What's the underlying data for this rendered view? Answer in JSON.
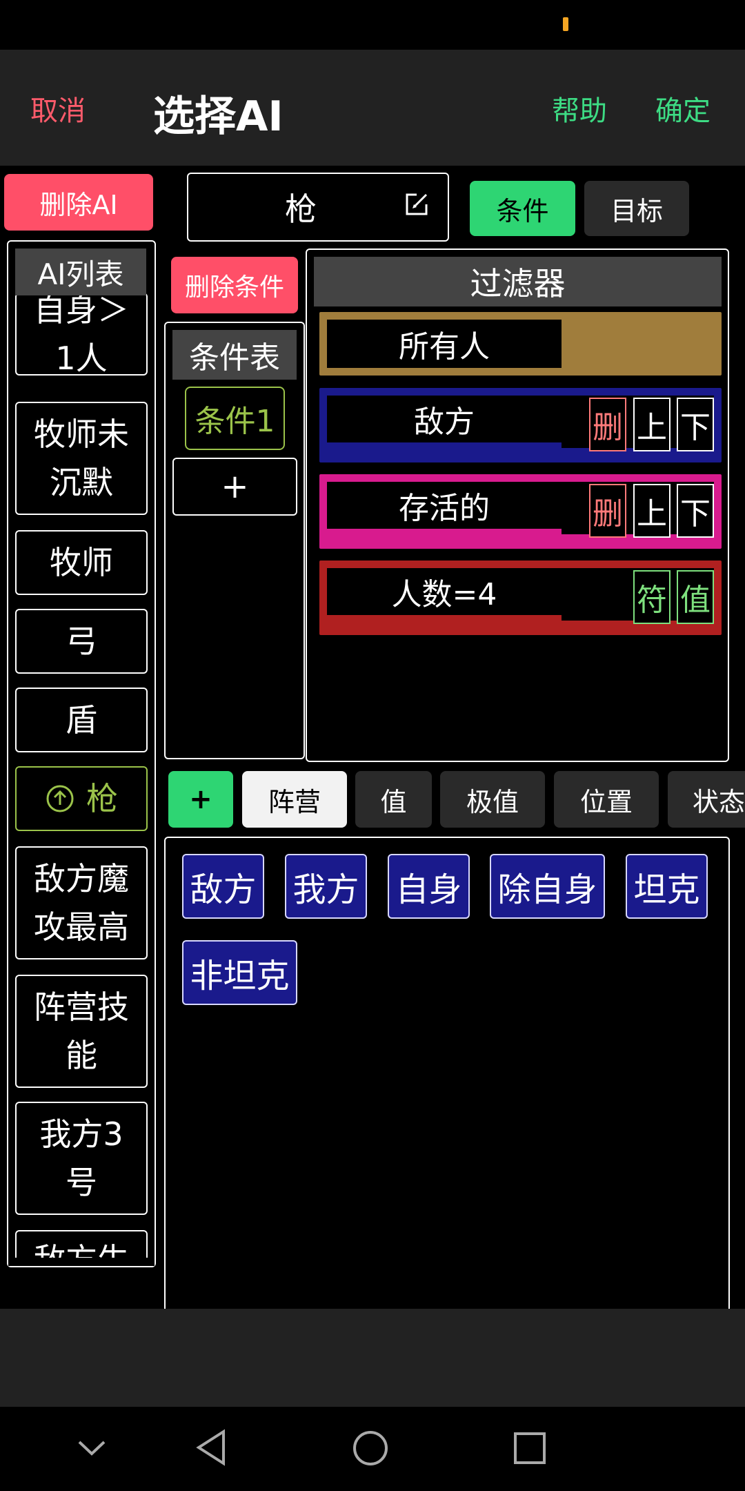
{
  "header": {
    "cancel": "取消",
    "title": "选择AI",
    "help": "帮助",
    "confirm": "确定"
  },
  "ai_panel": {
    "delete_button": "删除AI",
    "list_title": "AI列表",
    "items": [
      "自身＞\n1人",
      "牧师未\n沉默",
      "牧师",
      "弓",
      "盾",
      "枪",
      "敌方魔\n攻最高",
      "阵营技\n能",
      "我方3\n号",
      "敌方生"
    ],
    "selected": "枪"
  },
  "editor": {
    "name": "枪",
    "tab_condition": "条件",
    "tab_target": "目标"
  },
  "conditions": {
    "delete_button": "删除条件",
    "table_title": "条件表",
    "items": [
      "条件1"
    ],
    "add": "+"
  },
  "filter": {
    "title": "过滤器",
    "rows": [
      {
        "label": "所有人",
        "color": "#a07d3c",
        "buttons": []
      },
      {
        "label": "敌方",
        "color": "#1a1a8c",
        "buttons": [
          "删",
          "上",
          "下"
        ]
      },
      {
        "label": "存活的",
        "color": "#d81b8e",
        "buttons": [
          "删",
          "上",
          "下"
        ]
      },
      {
        "label": "人数=4",
        "color": "#b02020",
        "buttons": [
          "符",
          "值"
        ]
      }
    ]
  },
  "categories": {
    "add": "+",
    "items": [
      "阵营",
      "值",
      "极值",
      "位置",
      "状态"
    ],
    "selected": "阵营"
  },
  "options": [
    "敌方",
    "我方",
    "自身",
    "除自身",
    "坦克",
    "非坦克"
  ],
  "colors": {
    "accent_green": "#2ed573",
    "danger_red": "#ff4f68",
    "selected_green": "#9bc34a",
    "option_blue": "#1a1a8c"
  }
}
